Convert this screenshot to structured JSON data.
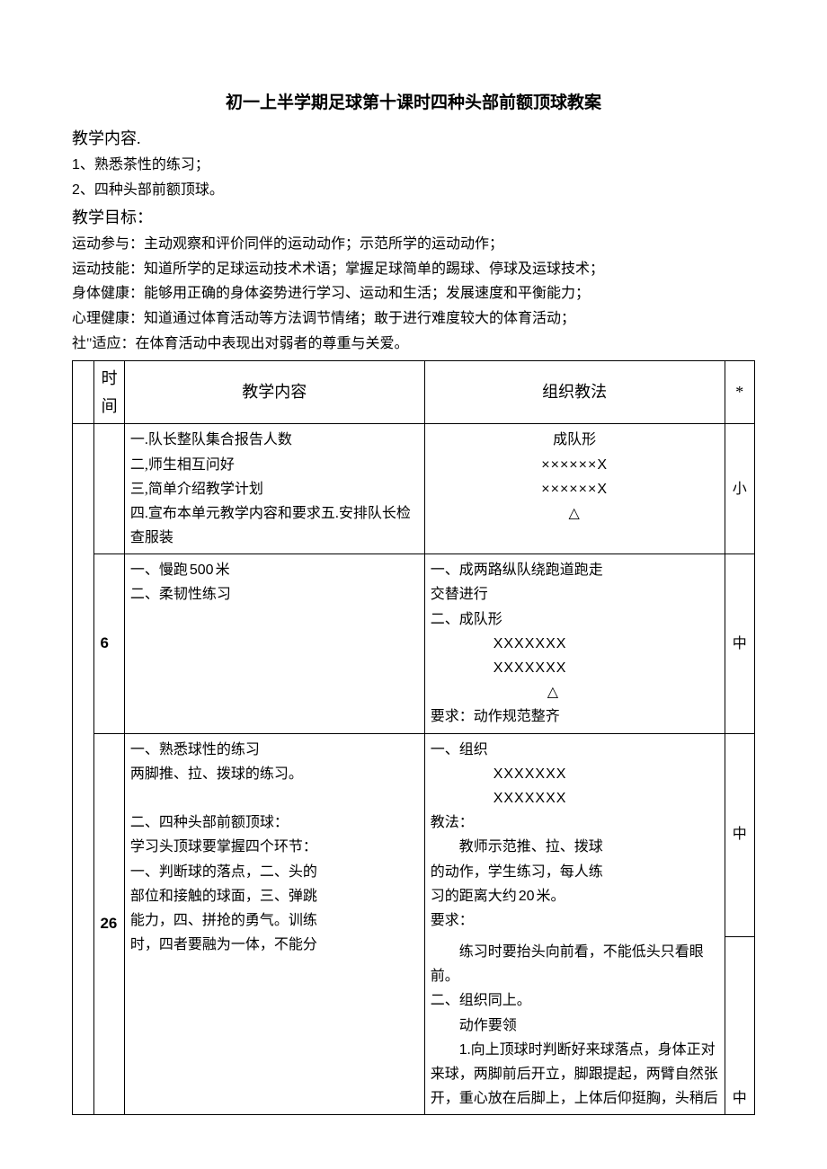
{
  "title": "初一上半学期足球第十课时四种头部前额顶球教案",
  "heading_content": "教学内容.",
  "content_items": {
    "i1_num": "1",
    "i1_text": "、熟悉茶性的练习；",
    "i2_num": "2",
    "i2_text": "、四种头部前额顶球。"
  },
  "heading_goals": "教学目标：",
  "goals": {
    "g1": "运动参与：主动观察和评价同伴的运动动作；示范所学的运动动作；",
    "g2": "运动技能：知道所学的足球运动技术术语；掌握足球简单的踢球、停球及运球技术；",
    "g3": "身体健康：能够用正确的身体姿势进行学习、运动和生活；发展速度和平衡能力；",
    "g4": "心理健康：知道通过体育活动等方法调节情绪；敢于进行难度较大的体育活动；",
    "g5": "社\"适应：在体育活动中表现出对弱者的尊重与关爱。"
  },
  "table": {
    "header": {
      "time": "时间",
      "content": "教学内容",
      "method": "组织教法",
      "star": "*"
    },
    "row1": {
      "time": "",
      "content": "一.队长整队集合报告人数\n二,师生相互问好\n三,简单介绍教学计划\n四.宣布本单元教学内容和要求五.安排队长检查服装",
      "method_title": "成队形",
      "method_f1": "××××××X",
      "method_f2": "××××××X",
      "method_tri": "△",
      "intensity": "小"
    },
    "row2": {
      "time": "6",
      "content_l1a": "一、慢跑",
      "content_l1_num": "500",
      "content_l1b": "米",
      "content_l2": "二、柔韧性练习",
      "method_l1": "一、成两路纵队绕跑道跑走",
      "method_l2": "交替进行",
      "method_l3": "二、成队形",
      "method_f1": "XXXXXXX",
      "method_f2": "XXXXXXX",
      "method_tri": "△",
      "method_req": "要求：动作规范整齐",
      "intensity": "中"
    },
    "row3": {
      "time": "26",
      "c_l1": "一、熟悉球性的练习",
      "c_l2": "两脚推、拉、拨球的练习。",
      "c_l3": "",
      "c_l4": "二、四种头部前额顶球：",
      "c_l5": "学习头顶球要掌握四个环节：",
      "c_l6": "一、判断球的落点，二、头的",
      "c_l7": "部位和接触的球面，三、弹跳",
      "c_l8": "能力，四、拼抢的勇气。训练",
      "c_l9": "时，四者要融为一体，不能分",
      "m_l1": "一、组织",
      "m_f1": "XXXXXXX",
      "m_f2": "XXXXXXX",
      "m_l2": "教法：",
      "m_l3": "教师示范推、拉、拨球",
      "m_l4": "的动作，学生练习，每人练",
      "m_l5a": "习的距离大约",
      "m_l5_num": "20",
      "m_l5b": "米。",
      "m_l6": "要求：",
      "m_l7": "练习时要抬头向前看，不能低头只看眼前。",
      "m_l8": "二、组织同上。",
      "m_l9": "动作要领",
      "m_l10a": "1",
      "m_l10b": ".向上顶球时判断好来球落点，身体正对来球，两脚前后开立，脚跟提起，两臂自然张开，重心放在后脚上，上体后仰挺胸，头稍后",
      "intensity1": "中",
      "intensity2": "中"
    }
  }
}
